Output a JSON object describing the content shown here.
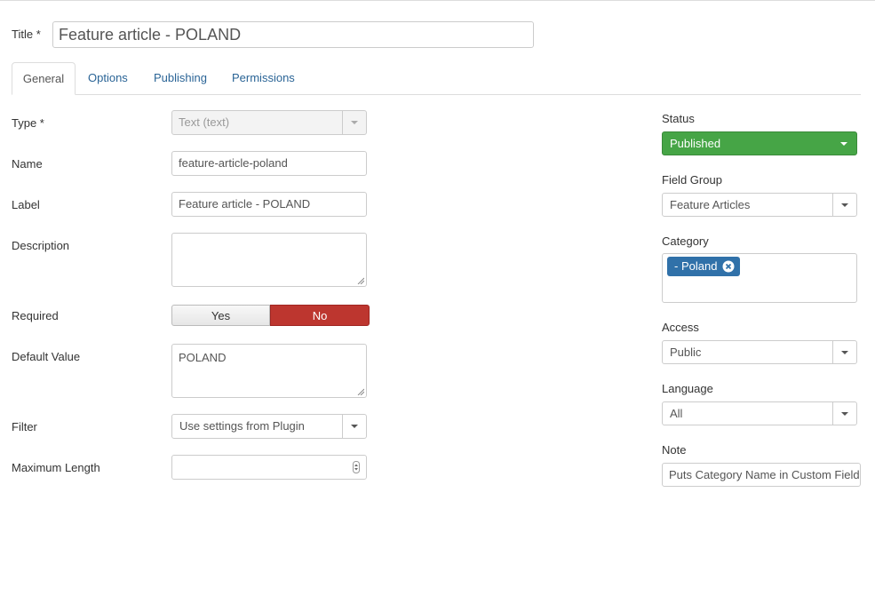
{
  "title": {
    "label": "Title *",
    "value": "Feature article - POLAND"
  },
  "tabs": [
    {
      "label": "General"
    },
    {
      "label": "Options"
    },
    {
      "label": "Publishing"
    },
    {
      "label": "Permissions"
    }
  ],
  "general": {
    "type": {
      "label": "Type *",
      "value": "Text (text)"
    },
    "name": {
      "label": "Name",
      "value": "feature-article-poland"
    },
    "field_label": {
      "label": "Label",
      "value": "Feature article - POLAND"
    },
    "description": {
      "label": "Description",
      "value": ""
    },
    "required": {
      "label": "Required",
      "yes": "Yes",
      "no": "No",
      "selected": "No"
    },
    "default_value": {
      "label": "Default Value",
      "value": "POLAND"
    },
    "filter": {
      "label": "Filter",
      "value": "Use settings from Plugin"
    },
    "max_length": {
      "label": "Maximum Length",
      "value": ""
    }
  },
  "sidebar": {
    "status": {
      "label": "Status",
      "value": "Published",
      "color": "#46a546"
    },
    "field_group": {
      "label": "Field Group",
      "value": "Feature Articles"
    },
    "category": {
      "label": "Category",
      "chip": "- Poland",
      "chip_color": "#3071a9"
    },
    "access": {
      "label": "Access",
      "value": "Public"
    },
    "language": {
      "label": "Language",
      "value": "All"
    },
    "note": {
      "label": "Note",
      "value": "Puts Category Name in Custom Field"
    }
  },
  "colors": {
    "link": "#2a6496",
    "toggle_no": "#bd362f"
  }
}
